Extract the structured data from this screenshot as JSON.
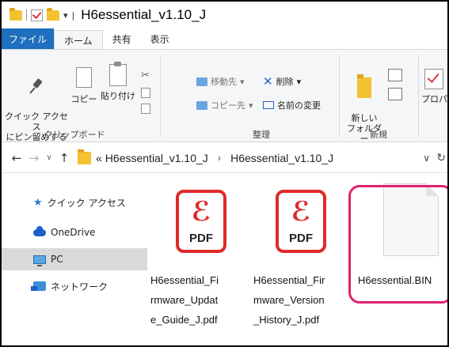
{
  "window": {
    "title": "H6essential_v1.10_J"
  },
  "quick_access_toolbar": {
    "dropdown_glyph": "▾",
    "separator": "|"
  },
  "ribbon_tabs": [
    {
      "label": "ファイル"
    },
    {
      "label": "ホーム",
      "active": true
    },
    {
      "label": "共有"
    },
    {
      "label": "表示"
    }
  ],
  "ribbon": {
    "clipboard": {
      "pin_label": "クイック アクセス\nにピン留めする",
      "copy_label": "コピー",
      "paste_label": "貼り付け",
      "group_label": "クリップボード"
    },
    "organize": {
      "move_to": "移動先",
      "copy_to": "コピー先",
      "delete": "削除",
      "rename": "名前の変更",
      "group_label": "整理"
    },
    "new": {
      "new_folder": "新しい\nフォルダー",
      "group_label": "新規"
    },
    "open": {
      "properties": "プロパテ"
    }
  },
  "address_bar": {
    "overflow": "«",
    "segments": [
      "H6essential_v1.10_J",
      "H6essential_v1.10_J"
    ],
    "separator": "›"
  },
  "nav_pane": [
    {
      "label": "クイック アクセス",
      "icon": "star-icon"
    },
    {
      "label": "OneDrive",
      "icon": "cloud-icon"
    },
    {
      "label": "PC",
      "icon": "pc-icon",
      "selected": true
    },
    {
      "label": "ネットワーク",
      "icon": "network-icon"
    }
  ],
  "files": [
    {
      "name": "H6essential_Fi\nrmware_Updat\ne_Guide_J.pdf",
      "icon_text": "PDF",
      "type": "pdf"
    },
    {
      "name": "H6essential_Fir\nmware_Version\n_History_J.pdf",
      "icon_text": "PDF",
      "type": "pdf"
    },
    {
      "name": "H6essential.BIN",
      "type": "bin",
      "highlighted": true
    }
  ],
  "colors": {
    "file_tab": "#1e6fbe",
    "pdf_red": "#e0292a",
    "highlight": "#e0236d",
    "folder": "#f2c230"
  }
}
